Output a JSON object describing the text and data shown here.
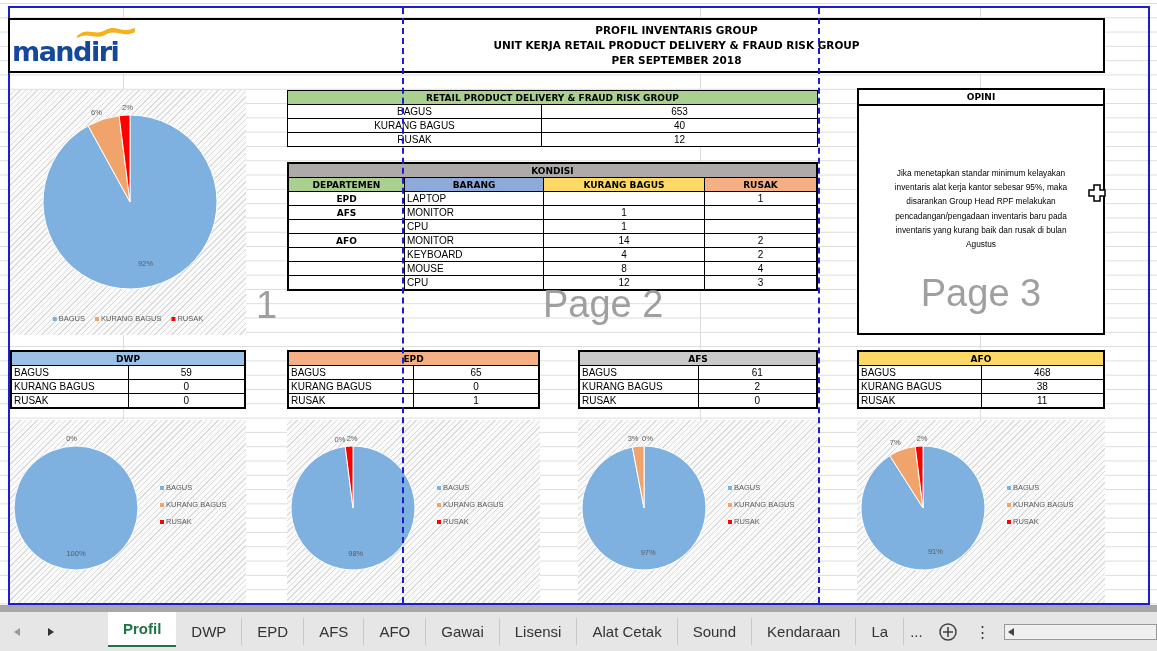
{
  "header": {
    "logo_text": "mandiri",
    "title_lines": [
      "PROFIL INVENTARIS GROUP",
      "UNIT KERJA RETAIL PRODUCT DELIVERY & FRAUD RISK GROUP",
      "PER SEPTEMBER 2018"
    ]
  },
  "main_chart": {
    "chart_data": {
      "type": "pie",
      "categories": [
        "BAGUS",
        "KURANG BAGUS",
        "RUSAK"
      ],
      "colors": [
        "#7fb1e0",
        "#f0a46c",
        "#ff0000"
      ],
      "values": [
        92,
        6,
        2
      ],
      "value_labels": [
        "92%",
        "6%",
        "2%"
      ],
      "legend": "bottom"
    }
  },
  "summary": {
    "title": "RETAIL PRODUCT DELIVERY & FRAUD RISK GROUP",
    "color": "#a9d08e",
    "rows": [
      {
        "label": "BAGUS",
        "value": "653"
      },
      {
        "label": "KURANG BAGUS",
        "value": "40"
      },
      {
        "label": "RUSAK",
        "value": "12"
      }
    ]
  },
  "kondisi": {
    "title": "KONDISI",
    "columns": [
      {
        "label": "DEPARTEMEN",
        "color": "#a9d08e"
      },
      {
        "label": "BARANG",
        "color": "#8eaadb"
      },
      {
        "label": "KURANG BAGUS",
        "color": "#ffd966"
      },
      {
        "label": "RUSAK",
        "color": "#f4b084"
      }
    ],
    "rows": [
      {
        "departemen": "EPD",
        "barang": "LAPTOP",
        "rusak": "1"
      },
      {
        "departemen": "AFS",
        "barang": "MONITOR",
        "kurang_bagus": "1"
      },
      {
        "barang": "CPU",
        "kurang_bagus": "1"
      },
      {
        "departemen": "AFO",
        "barang": "MONITOR",
        "kurang_bagus": "14",
        "rusak": "2"
      },
      {
        "barang": "KEYBOARD",
        "kurang_bagus": "4",
        "rusak": "2"
      },
      {
        "barang": "MOUSE",
        "kurang_bagus": "8",
        "rusak": "4"
      },
      {
        "barang": "CPU",
        "kurang_bagus": "12",
        "rusak": "3"
      }
    ]
  },
  "opini": {
    "title": "OPINI",
    "text": "Jika menetapkan standar minimum kelayakan inventaris alat kerja kantor sebesar 95%, maka disarankan Group Head RPF melakukan pencadangan/pengadaan inventaris baru pada inventaris yang kurang baik dan rusak di bulan Agustus"
  },
  "page_labels": [
    "1",
    "Page 2",
    "Page 3"
  ],
  "departments": [
    {
      "name": "DWP",
      "color": "#9bc2e6",
      "rows": [
        {
          "label": "BAGUS",
          "value": "59"
        },
        {
          "label": "KURANG BAGUS",
          "value": "0"
        },
        {
          "label": "RUSAK",
          "value": "0"
        }
      ],
      "chart_data": {
        "type": "pie",
        "categories": [
          "BAGUS",
          "KURANG BAGUS",
          "RUSAK"
        ],
        "colors": [
          "#7fb1e0",
          "#f0a46c",
          "#ff0000"
        ],
        "values": [
          100,
          0,
          0
        ],
        "value_labels": [
          "100%",
          "0%",
          null
        ],
        "legend": "right"
      }
    },
    {
      "name": "EPD",
      "color": "#f4b084",
      "rows": [
        {
          "label": "BAGUS",
          "value": "65"
        },
        {
          "label": "KURANG BAGUS",
          "value": "0"
        },
        {
          "label": "RUSAK",
          "value": "1"
        }
      ],
      "chart_data": {
        "type": "pie",
        "categories": [
          "BAGUS",
          "KURANG BAGUS",
          "RUSAK"
        ],
        "colors": [
          "#7fb1e0",
          "#f0a46c",
          "#ff0000"
        ],
        "values": [
          98,
          0,
          2
        ],
        "value_labels": [
          "98%",
          "0%",
          "2%"
        ],
        "legend": "right"
      }
    },
    {
      "name": "AFS",
      "color": "#c9c9c9",
      "rows": [
        {
          "label": "BAGUS",
          "value": "61"
        },
        {
          "label": "KURANG BAGUS",
          "value": "2"
        },
        {
          "label": "RUSAK",
          "value": "0"
        }
      ],
      "chart_data": {
        "type": "pie",
        "categories": [
          "BAGUS",
          "KURANG BAGUS",
          "RUSAK"
        ],
        "colors": [
          "#7fb1e0",
          "#f0a46c",
          "#ff0000"
        ],
        "values": [
          97,
          3,
          0
        ],
        "value_labels": [
          "97%",
          "3%",
          "0%"
        ],
        "legend": "right"
      }
    },
    {
      "name": "AFO",
      "color": "#ffd966",
      "rows": [
        {
          "label": "BAGUS",
          "value": "468"
        },
        {
          "label": "KURANG BAGUS",
          "value": "38"
        },
        {
          "label": "RUSAK",
          "value": "11"
        }
      ],
      "chart_data": {
        "type": "pie",
        "categories": [
          "BAGUS",
          "KURANG BAGUS",
          "RUSAK"
        ],
        "colors": [
          "#7fb1e0",
          "#f0a46c",
          "#ff0000"
        ],
        "values": [
          91,
          7,
          2
        ],
        "value_labels": [
          "91%",
          "7%",
          "2%"
        ],
        "legend": "right"
      }
    }
  ],
  "sheet_tabs": [
    {
      "label": "Profil",
      "selected": true
    },
    {
      "label": "DWP",
      "selected": false
    },
    {
      "label": "EPD",
      "selected": false
    },
    {
      "label": "AFS",
      "selected": false
    },
    {
      "label": "AFO",
      "selected": false
    },
    {
      "label": "Gawai",
      "selected": false
    },
    {
      "label": "Lisensi",
      "selected": false
    },
    {
      "label": "Alat Cetak",
      "selected": false
    },
    {
      "label": "Sound",
      "selected": false
    },
    {
      "label": "Kendaraan",
      "selected": false
    },
    {
      "label": "La",
      "selected": false
    }
  ],
  "more_tabs": "...",
  "options_glyph": "⋮"
}
